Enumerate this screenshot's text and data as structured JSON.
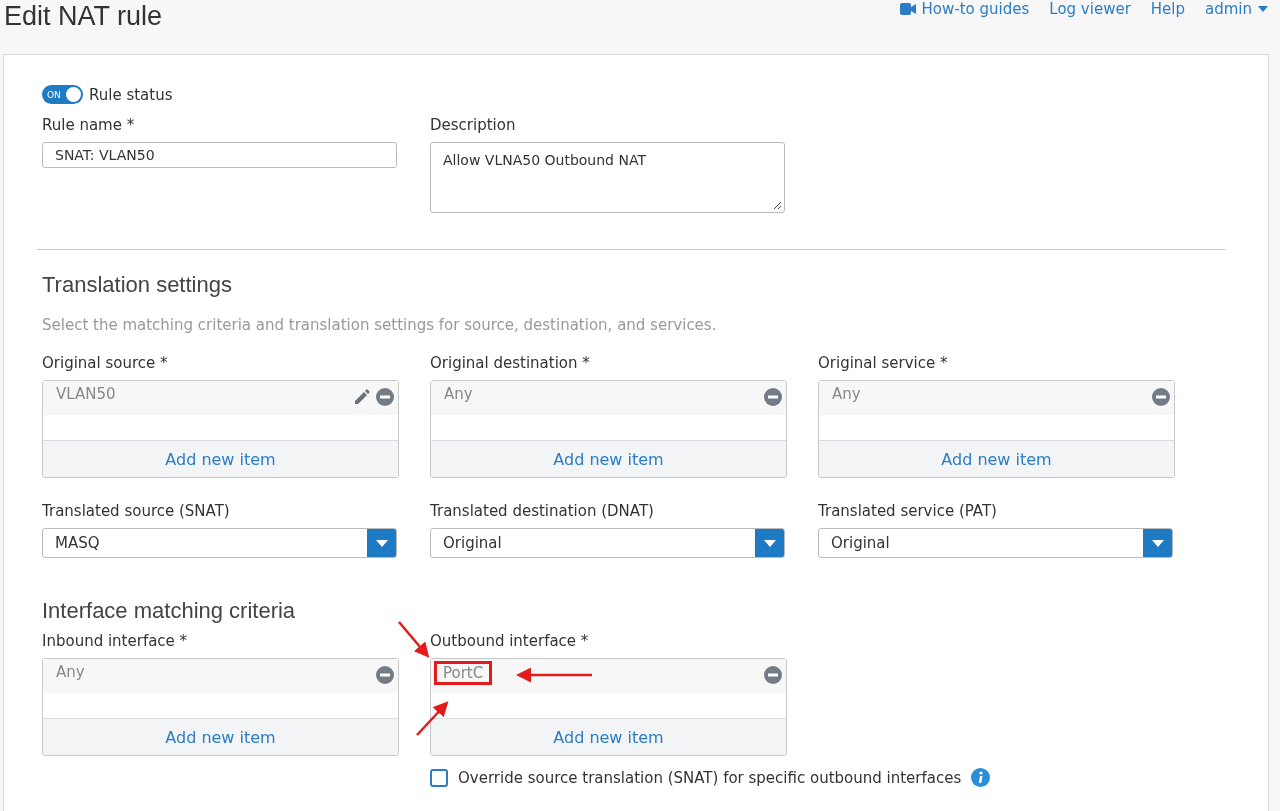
{
  "header": {
    "title": "Edit NAT rule",
    "links": [
      {
        "label": "How-to guides",
        "kind": "video"
      },
      {
        "label": "Log viewer",
        "kind": "plain"
      },
      {
        "label": "Help",
        "kind": "plain"
      }
    ],
    "user_menu": "admin"
  },
  "rule_status": {
    "label": "Rule status",
    "toggle_text": "ON",
    "on": true
  },
  "rule_name": {
    "label": "Rule name *",
    "value": "SNAT: VLAN50"
  },
  "description": {
    "label": "Description",
    "value": "Allow VLNA50 Outbound NAT"
  },
  "translation": {
    "title": "Translation settings",
    "subtitle": "Select the matching criteria and translation settings for source, destination, and services.",
    "lists": [
      {
        "label": "Original source *",
        "add_label": "Add new item",
        "items": [
          {
            "text": "VLAN50",
            "editable": true,
            "highlighted": false
          }
        ]
      },
      {
        "label": "Original destination *",
        "add_label": "Add new item",
        "items": [
          {
            "text": "Any",
            "editable": false,
            "highlighted": false
          }
        ]
      },
      {
        "label": "Original service *",
        "add_label": "Add new item",
        "items": [
          {
            "text": "Any",
            "editable": false,
            "highlighted": false
          }
        ]
      }
    ],
    "selects": [
      {
        "label": "Translated source (SNAT)",
        "value": "MASQ"
      },
      {
        "label": "Translated destination (DNAT)",
        "value": "Original"
      },
      {
        "label": "Translated service (PAT)",
        "value": "Original"
      }
    ]
  },
  "interface": {
    "title": "Interface matching criteria",
    "lists": [
      {
        "label": "Inbound interface *",
        "add_label": "Add new item",
        "items": [
          {
            "text": "Any",
            "editable": false,
            "highlighted": false
          }
        ]
      },
      {
        "label": "Outbound interface *",
        "add_label": "Add new item",
        "items": [
          {
            "text": "PortC",
            "editable": false,
            "highlighted": true
          }
        ]
      }
    ]
  },
  "override": {
    "label": "Override source translation (SNAT) for specific outbound interfaces",
    "checked": false
  }
}
